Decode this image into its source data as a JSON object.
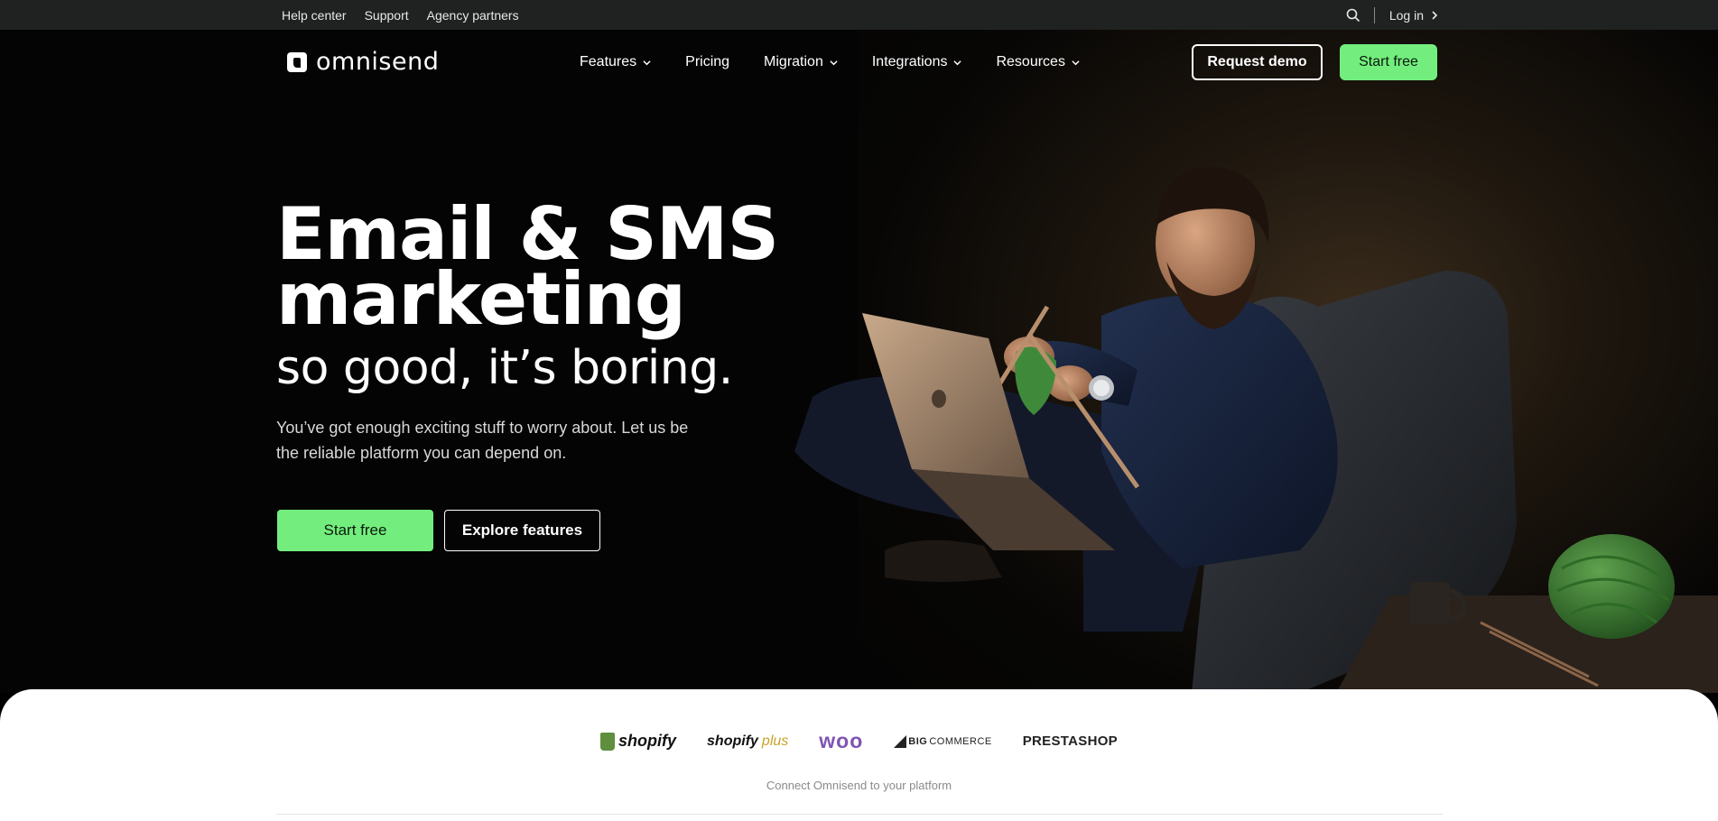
{
  "topbar": {
    "links": [
      "Help center",
      "Support",
      "Agency partners"
    ],
    "search_icon": "search-icon",
    "login_label": "Log in"
  },
  "nav": {
    "logo_text": "omnisend",
    "items": [
      {
        "label": "Features",
        "has_dropdown": true
      },
      {
        "label": "Pricing",
        "has_dropdown": false
      },
      {
        "label": "Migration",
        "has_dropdown": true
      },
      {
        "label": "Integrations",
        "has_dropdown": true
      },
      {
        "label": "Resources",
        "has_dropdown": true
      }
    ],
    "request_demo": "Request demo",
    "start_free": "Start free"
  },
  "hero": {
    "headline_line1": "Email & SMS",
    "headline_line2": "marketing",
    "subheadline": "so good, it’s boring.",
    "lead": "You’ve got enough exciting stuff to worry about. Let us be the reliable platform you can depend on.",
    "cta_primary": "Start free",
    "cta_secondary": "Explore features"
  },
  "platforms": {
    "logos": [
      "shopify",
      "shopify",
      "plus",
      "woo",
      "BIG",
      "COMMERCE",
      "PRESTASHOP"
    ],
    "caption": "Connect Omnisend to your platform"
  },
  "colors": {
    "accent_green": "#73ee7e",
    "topbar_bg": "#1f2220",
    "woo_purple": "#7f54b3",
    "shopify_green": "#5e8e3e"
  }
}
